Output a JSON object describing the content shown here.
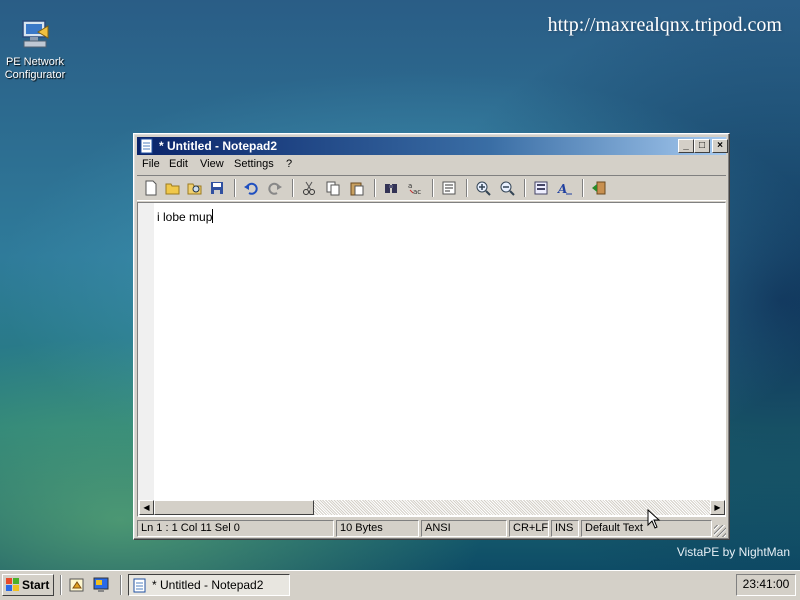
{
  "desktop": {
    "icon_label_line1": "PE Network",
    "icon_label_line2": "Configurator",
    "url_text": "http://maxrealqnx.tripod.com",
    "watermark": "VistaPE by NightMan"
  },
  "window": {
    "title": "* Untitled - Notepad2",
    "controls": {
      "minimize": "_",
      "maximize": "□",
      "close": "×"
    },
    "menu": [
      "File",
      "Edit",
      "View",
      "Settings",
      "?"
    ],
    "toolbar_icons": [
      "new-file-icon",
      "open-folder-icon",
      "browse-icon",
      "save-icon",
      "undo-icon",
      "redo-icon",
      "cut-icon",
      "copy-icon",
      "paste-icon",
      "find-icon",
      "replace-icon",
      "word-wrap-icon",
      "zoom-in-icon",
      "zoom-out-icon",
      "scheme-icon",
      "font-icon",
      "exit-icon"
    ],
    "editor_text": "i lobe mup",
    "status": {
      "position": "Ln 1 : 1   Col 11   Sel 0",
      "size": "10 Bytes",
      "encoding": "ANSI",
      "line_endings": "CR+LF",
      "mode": "INS",
      "scheme": "Default Text"
    }
  },
  "taskbar": {
    "start_label": "Start",
    "task_button_label": "* Untitled - Notepad2",
    "clock": "23:41:00"
  }
}
